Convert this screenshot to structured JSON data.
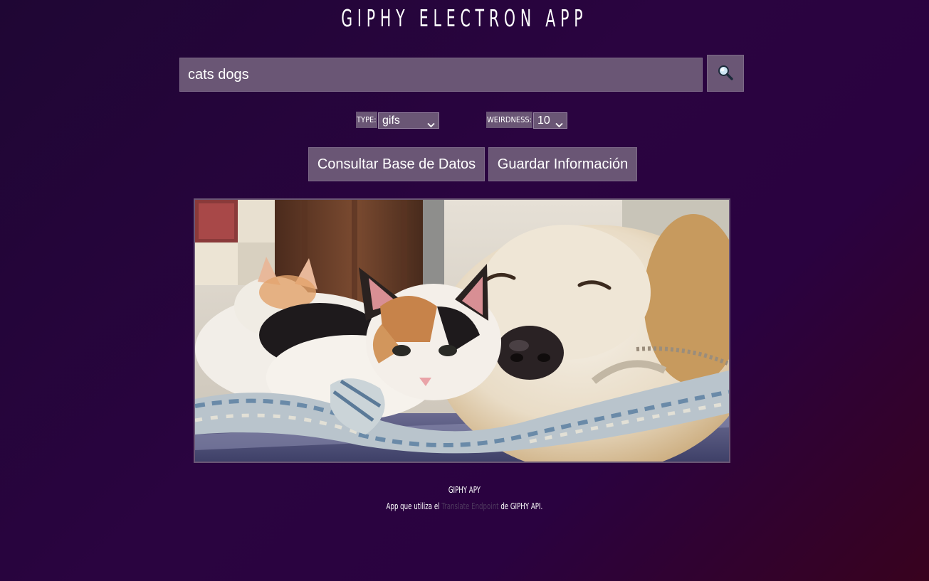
{
  "app": {
    "title": "GIPHY ELECTRON APP"
  },
  "search": {
    "value": "cats dogs",
    "button_icon": "magnifier-icon"
  },
  "filters": {
    "type_label": "TYPE:",
    "type_value": "gifs",
    "weirdness_label": "WEIRDNESS:",
    "weirdness_value": "10"
  },
  "actions": {
    "consult_label": "Consultar Base de Datos",
    "save_label": "Guardar Información"
  },
  "footer": {
    "title": "GIPHY APY",
    "text_before": "App que utiliza el",
    "link_text": "Translate Endpoint",
    "text_after": "de GIPHY API."
  },
  "colors": {
    "background_start": "#1f0634",
    "background_end": "#38021e",
    "control": "#6a5675",
    "link": "#4e3a5e"
  }
}
